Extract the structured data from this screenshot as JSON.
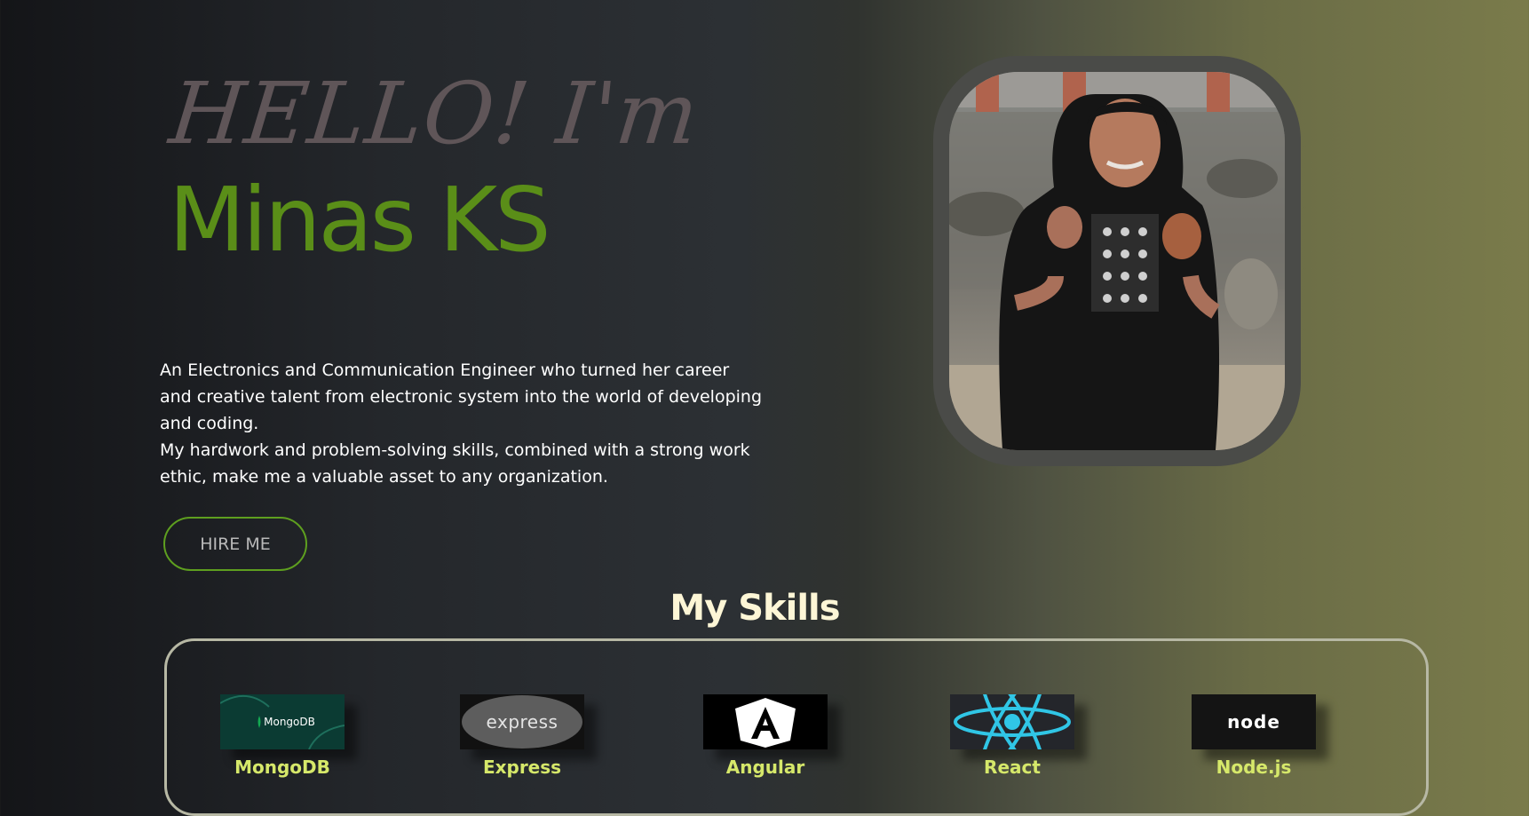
{
  "hero": {
    "greeting": "HELLO! I'm",
    "name": "Minas KS",
    "intro_line1": "An Electronics and Communication Engineer who turned her career and creative talent from electronic system into the world of developing and coding.",
    "intro_line2": "My hardwork and problem-solving skills, combined with a strong work ethic, make me a valuable asset to any organization.",
    "hire_button": "HIRE ME"
  },
  "skills": {
    "title": "My Skills",
    "items": [
      {
        "logo_text": "MongoDB",
        "label": "MongoDB",
        "icon": "mongodb-logo"
      },
      {
        "logo_text": "express",
        "label": "Express",
        "icon": "express-logo"
      },
      {
        "logo_text": "A",
        "label": "Angular",
        "icon": "angular-logo"
      },
      {
        "logo_text": "",
        "label": "React",
        "icon": "react-logo"
      },
      {
        "logo_text": "node",
        "label": "Node.js",
        "icon": "nodejs-logo"
      }
    ]
  },
  "colors": {
    "accent_green": "#5a8e18",
    "button_border": "#5e9f1f",
    "skills_title": "#fdf6d6"
  }
}
